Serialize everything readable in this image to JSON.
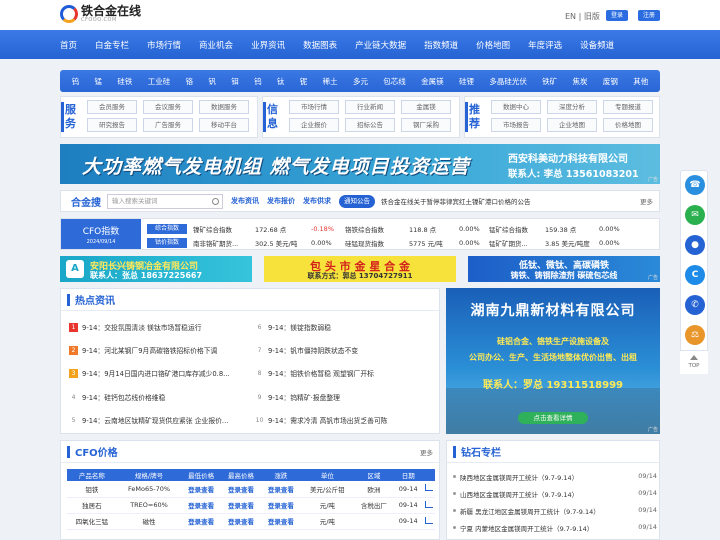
{
  "header": {
    "logo_cn": "铁合金在线",
    "logo_en": "CFOOO.COM",
    "lang": "EN | 旧版",
    "login": "登录",
    "register": "注册"
  },
  "nav": [
    "首页",
    "白金专栏",
    "市场行情",
    "商业机会",
    "业界资讯",
    "数据图表",
    "产业链大数据",
    "指数频道",
    "价格地图",
    "年度评选",
    "设备频道"
  ],
  "categories": [
    "钨",
    "锰",
    "硅铁",
    "工业硅",
    "铬",
    "钒",
    "钼",
    "钨",
    "钛",
    "铌",
    "稀土",
    "多元",
    "包芯线",
    "金属镁",
    "硅锂",
    "多晶硅光伏",
    "铁矿",
    "焦炭",
    "废钢",
    "其他"
  ],
  "services": [
    {
      "title": "服务",
      "items": [
        "会员服务",
        "会议服务",
        "数据服务",
        "研究报告",
        "广告服务",
        "移动平台"
      ]
    },
    {
      "title": "信息",
      "items": [
        "市场行情",
        "行业新闻",
        "金属镁",
        "企业报价",
        "招标公告",
        "钢厂采购"
      ]
    },
    {
      "title": "推荐",
      "items": [
        "数据中心",
        "深度分析",
        "专题报道",
        "市场报告",
        "企业地图",
        "价格地图"
      ]
    }
  ],
  "banner1": {
    "main": "大功率燃气发电机组  燃气发电项目投资运营",
    "company": "西安科美动力科技有限公司",
    "tel": "联系人: 李总  13561083201",
    "ad": "广告"
  },
  "search": {
    "title": "合金搜",
    "placeholder": "输入搜索关键词",
    "links": [
      "发布资讯",
      "发布报价",
      "发布供求"
    ],
    "notice": "通知公告",
    "message": "铁合金在线关于暂停菲律宾红土镍矿港口价格的公告",
    "more": "更多"
  },
  "cfo_index": {
    "title": "CFO指数",
    "date": "2024/09/14",
    "rows": [
      {
        "tag": "综合指数",
        "cells": [
          "镍矿综合指数",
          "172.68 点",
          "-0.18%",
          "铬铁综合指数",
          "118.8 点",
          "0.00%",
          "锰矿综合指数",
          "159.38 点",
          "0.00%"
        ]
      },
      {
        "tag": "钴价指数",
        "cells": [
          "南非铬矿期货...",
          "302.5 美元/吨",
          "0.00%",
          "硅锰现货指数",
          "5775 元/吨",
          "0.00%",
          "锰矿矿期货...",
          "3.85 美元/吨度",
          "0.00%"
        ]
      }
    ]
  },
  "ads3": [
    {
      "line1": "安阳长兴铸钢冶金有限公司",
      "line2": "联系人：张总 18637225667"
    },
    {
      "line1": "包 头 市 金 星 合 金",
      "line2": "联系方式：郭总 13704727911"
    },
    {
      "line1": "低钛、微钛、高碳磷铁",
      "line2": "铸铁、铸钢除渣剂 碳硫包芯线",
      "ad": "广告"
    }
  ],
  "hot": {
    "title": "热点资讯",
    "items": [
      {
        "n": "1",
        "t": "9-14：交投氛围清淡 镁钛市场暂稳运行"
      },
      {
        "n": "2",
        "t": "9-14：河北某钢厂9月高碳铬铁招标价格下调"
      },
      {
        "n": "3",
        "t": "9-14：9月14日国内进口铬矿港口库存减少0.8..."
      },
      {
        "n": "4",
        "t": "9-14：硅钙包芯线价格维稳"
      },
      {
        "n": "5",
        "t": "9-14：云南地区钛精矿现货供应紧张 企业报价..."
      },
      {
        "n": "6",
        "t": "9-14：镁锭指数弱稳"
      },
      {
        "n": "7",
        "t": "9-14：钒市僵持阴跌状态不变"
      },
      {
        "n": "8",
        "t": "9-14：钼铁价格暂稳 观望钢厂开标"
      },
      {
        "n": "9",
        "t": "9-14：钨精矿·报盘整理"
      },
      {
        "n": "10",
        "t": "9-14：需求冷清 高钒市场出货乏善可陈"
      }
    ]
  },
  "bigad": {
    "company": "湖南九鼎新材料有限公司",
    "line1": "硅铝合金、铬铁生产设施设备及",
    "line2": "公司办公、生产、生活场地整体优价出售、出租",
    "tel": "联系人：罗总 19311518999",
    "btn": "点击查看详情",
    "ad": "广告"
  },
  "price": {
    "title": "CFO价格",
    "more": "更多",
    "headers": [
      "产品名称",
      "规格/牌号",
      "最低价格",
      "最高价格",
      "涨跌",
      "单位",
      "区域",
      "日期",
      ""
    ],
    "rows": [
      [
        "钼铁",
        "FeMo65-70%",
        "登录查看",
        "登录查看",
        "登录查看",
        "美元/公斤钼",
        "欧洲",
        "09-14"
      ],
      [
        "独居石",
        "TREO=60%",
        "登录查看",
        "登录查看",
        "登录查看",
        "元/吨",
        "含税出厂",
        "09-14"
      ],
      [
        "四氧化三锰",
        "磁性",
        "登录查看",
        "登录查看",
        "登录查看",
        "元/吨",
        "",
        "09-14"
      ]
    ]
  },
  "column": {
    "title": "钻石专栏",
    "items": [
      {
        "t": "陕西地区金属镁周开工统计（9.7-9.14）",
        "d": "09/14"
      },
      {
        "t": "山西地区金属镁周开工统计（9.7-9.14）",
        "d": "09/14"
      },
      {
        "t": "新疆 黑龙江地区金属镁周开工统计（9.7-9.14）",
        "d": "09/14"
      },
      {
        "t": "宁夏 内蒙地区金属镁周开工统计（9.7-9.14）",
        "d": "09/14"
      }
    ]
  },
  "float": {
    "top": "TOP"
  },
  "colors": {
    "primary": "#2563d4",
    "red": "#e8352e",
    "orange": "#f07a2a"
  }
}
